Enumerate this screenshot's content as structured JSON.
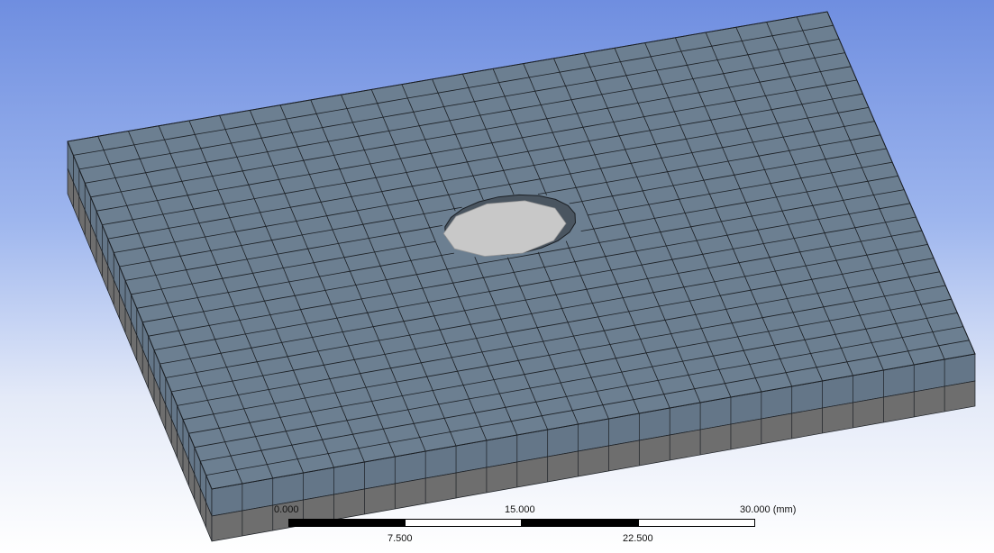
{
  "viewport": {
    "background_top": "#6f8ee0",
    "background_bottom": "#ffffff"
  },
  "model": {
    "face_top_color": "#6c7f91",
    "side_upper_color": "#647688",
    "side_lower_color": "#6e6e6e",
    "mesh_line_color": "#1b1f24",
    "hole_color": "#c8c8c8"
  },
  "scale_bar": {
    "label_0": "0.000",
    "label_mid": "15.000",
    "label_end": "30.000 (mm)",
    "label_q1": "7.500",
    "label_q3": "22.500"
  }
}
